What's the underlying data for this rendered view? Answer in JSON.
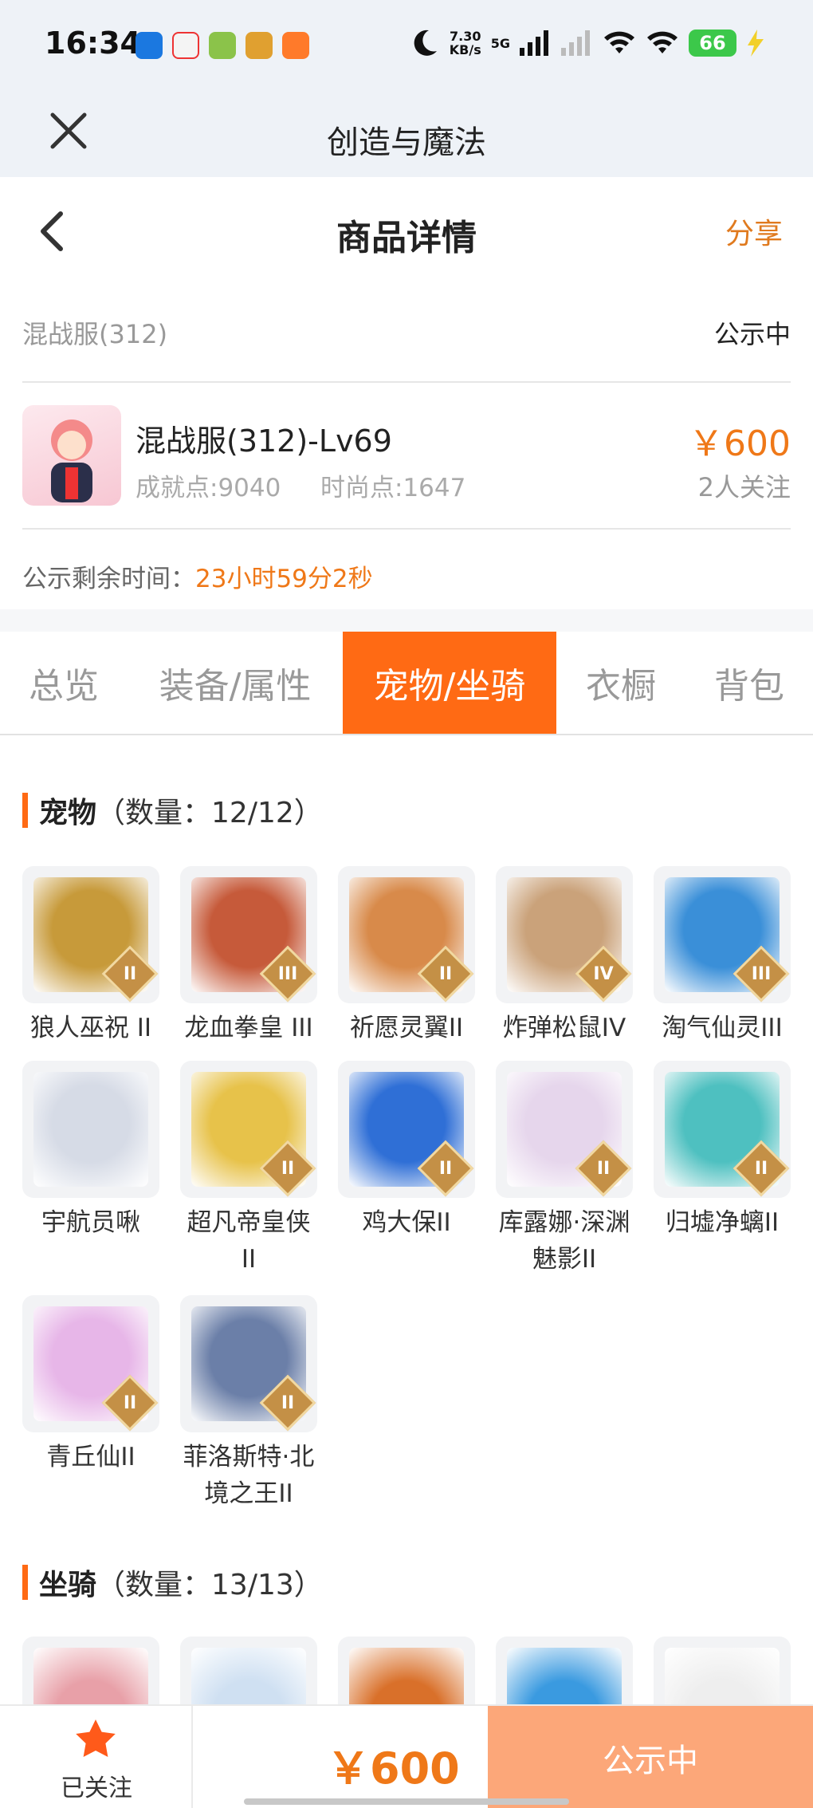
{
  "status_bar": {
    "time": "16:34",
    "net_speed_value": "7.30",
    "net_speed_unit": "KB/s",
    "network": "5G",
    "battery": "66"
  },
  "app_bar": {
    "title": "创造与魔法"
  },
  "page_header": {
    "title": "商品详情",
    "share": "分享"
  },
  "server": {
    "name": "混战服(312)",
    "status": "公示中"
  },
  "character": {
    "name": "混战服(312)-Lv69",
    "achievement": "成就点:9040",
    "fashion": "时尚点:1647",
    "price": "￥600",
    "followers": "2人关注"
  },
  "countdown": {
    "label": "公示剩余时间：",
    "value": "23小时59分2秒"
  },
  "tabs": [
    {
      "label": "总览"
    },
    {
      "label": "装备/属性"
    },
    {
      "label": "宠物/坐骑"
    },
    {
      "label": "衣橱"
    },
    {
      "label": "背包"
    }
  ],
  "pets_section": {
    "title": "宠物",
    "count": "（数量：12/12）"
  },
  "pets": [
    {
      "name": "狼人巫祝 II",
      "tier": "II",
      "color": "#c79a3a"
    },
    {
      "name": "龙血拳皇 III",
      "tier": "III",
      "color": "#c65a3a"
    },
    {
      "name": "祈愿灵翼II",
      "tier": "II",
      "color": "#d88a4a"
    },
    {
      "name": "炸弹松鼠IV",
      "tier": "IV",
      "color": "#caa27a"
    },
    {
      "name": "淘气仙灵III",
      "tier": "III",
      "color": "#3a8fd8"
    },
    {
      "name": "宇航员啾",
      "tier": "",
      "color": "#d6dbe6"
    },
    {
      "name": "超凡帝皇侠II",
      "tier": "II",
      "color": "#e7c24a"
    },
    {
      "name": "鸡大保II",
      "tier": "II",
      "color": "#2f6fd6"
    },
    {
      "name": "库露娜·深渊魅影II",
      "tier": "II",
      "color": "#e6d6ec"
    },
    {
      "name": "归墟净螭II",
      "tier": "II",
      "color": "#4ec0c0"
    },
    {
      "name": "青丘仙II",
      "tier": "II",
      "color": "#e7b6e8"
    },
    {
      "name": "菲洛斯特·北境之王II",
      "tier": "II",
      "color": "#6b7fa8"
    }
  ],
  "mounts_section": {
    "title": "坐骑",
    "count": "（数量：13/13）"
  },
  "mounts": [
    {
      "color": "#e8a0a8"
    },
    {
      "color": "#cfe0f2"
    },
    {
      "color": "#d9702a"
    },
    {
      "color": "#3a9ae0"
    },
    {
      "color": "#eeeeee"
    }
  ],
  "bottom_bar": {
    "follow_label": "已关注",
    "price": "￥600",
    "status_button": "公示中"
  }
}
